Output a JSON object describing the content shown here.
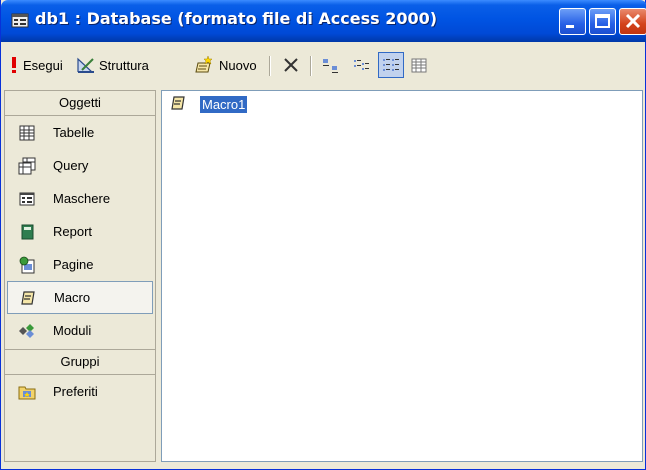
{
  "window": {
    "title": "db1 : Database (formato file di Access 2000)"
  },
  "toolbar": {
    "run_label": "Esegui",
    "design_label": "Struttura",
    "new_label": "Nuovo"
  },
  "objects_panel": {
    "objects_header": "Oggetti",
    "items": [
      {
        "label": "Tabelle",
        "icon": "table-icon"
      },
      {
        "label": "Query",
        "icon": "query-icon"
      },
      {
        "label": "Maschere",
        "icon": "form-icon"
      },
      {
        "label": "Report",
        "icon": "report-icon"
      },
      {
        "label": "Pagine",
        "icon": "page-icon"
      },
      {
        "label": "Macro",
        "icon": "macro-icon",
        "selected": true
      },
      {
        "label": "Moduli",
        "icon": "module-icon"
      }
    ],
    "groups_header": "Gruppi",
    "groups": [
      {
        "label": "Preferiti",
        "icon": "favorites-folder-icon"
      }
    ]
  },
  "list": {
    "items": [
      {
        "label": "Macro1",
        "icon": "macro-icon",
        "selected": true
      }
    ]
  },
  "colors": {
    "title_bar": "#0054e3",
    "selection": "#316ac5",
    "close_button": "#d4431c"
  }
}
